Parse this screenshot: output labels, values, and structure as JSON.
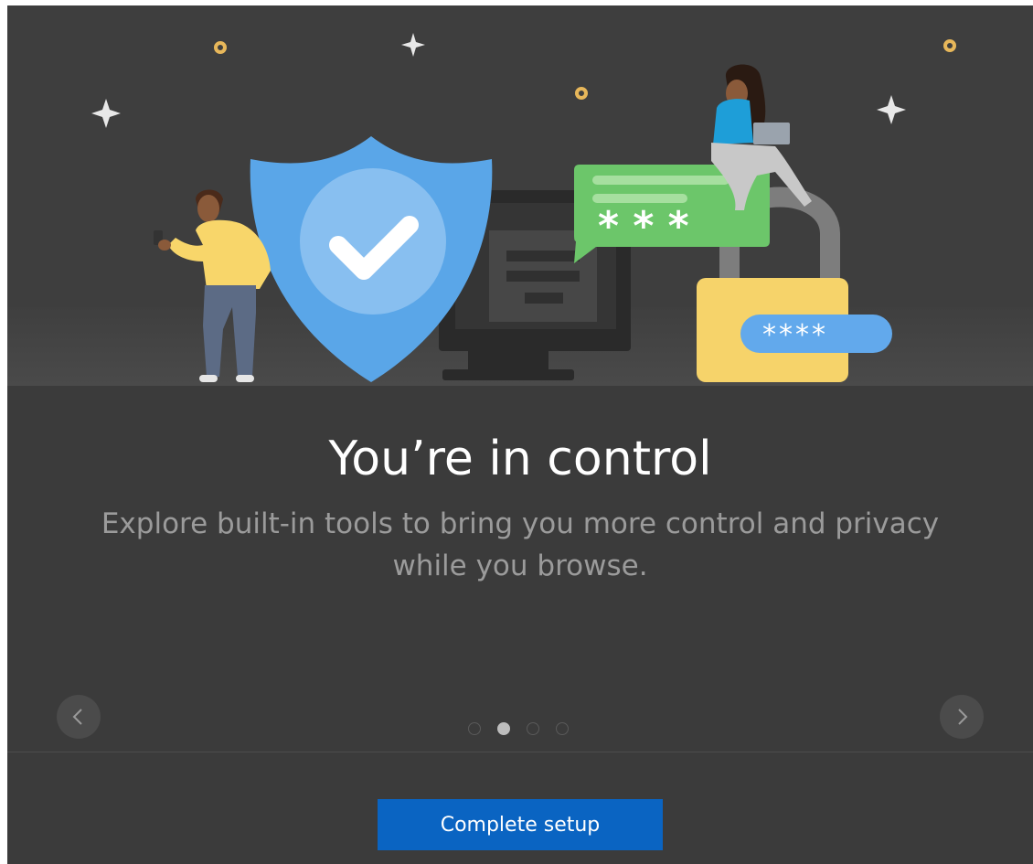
{
  "dialog": {
    "title": "You’re in control",
    "description": "Explore built-in tools to bring you more control and privacy while you browse.",
    "illustration": {
      "name": "privacy-illustration",
      "password_bubble_text": "* * *",
      "pin_tag_text": "****"
    }
  },
  "carousel": {
    "prev_icon": "chevron-left-icon",
    "next_icon": "chevron-right-icon",
    "total_pages": 4,
    "current_page": 2,
    "pages": [
      "page-1",
      "page-2",
      "page-3",
      "page-4"
    ]
  },
  "footer": {
    "complete_label": "Complete setup"
  },
  "colors": {
    "background": "#3b3b3b",
    "primary_button": "#0a64c2",
    "shield": "#5aa6e8",
    "bubble": "#6cc66a",
    "lock": "#f6d36a",
    "pin_tag": "#62a9ec"
  }
}
